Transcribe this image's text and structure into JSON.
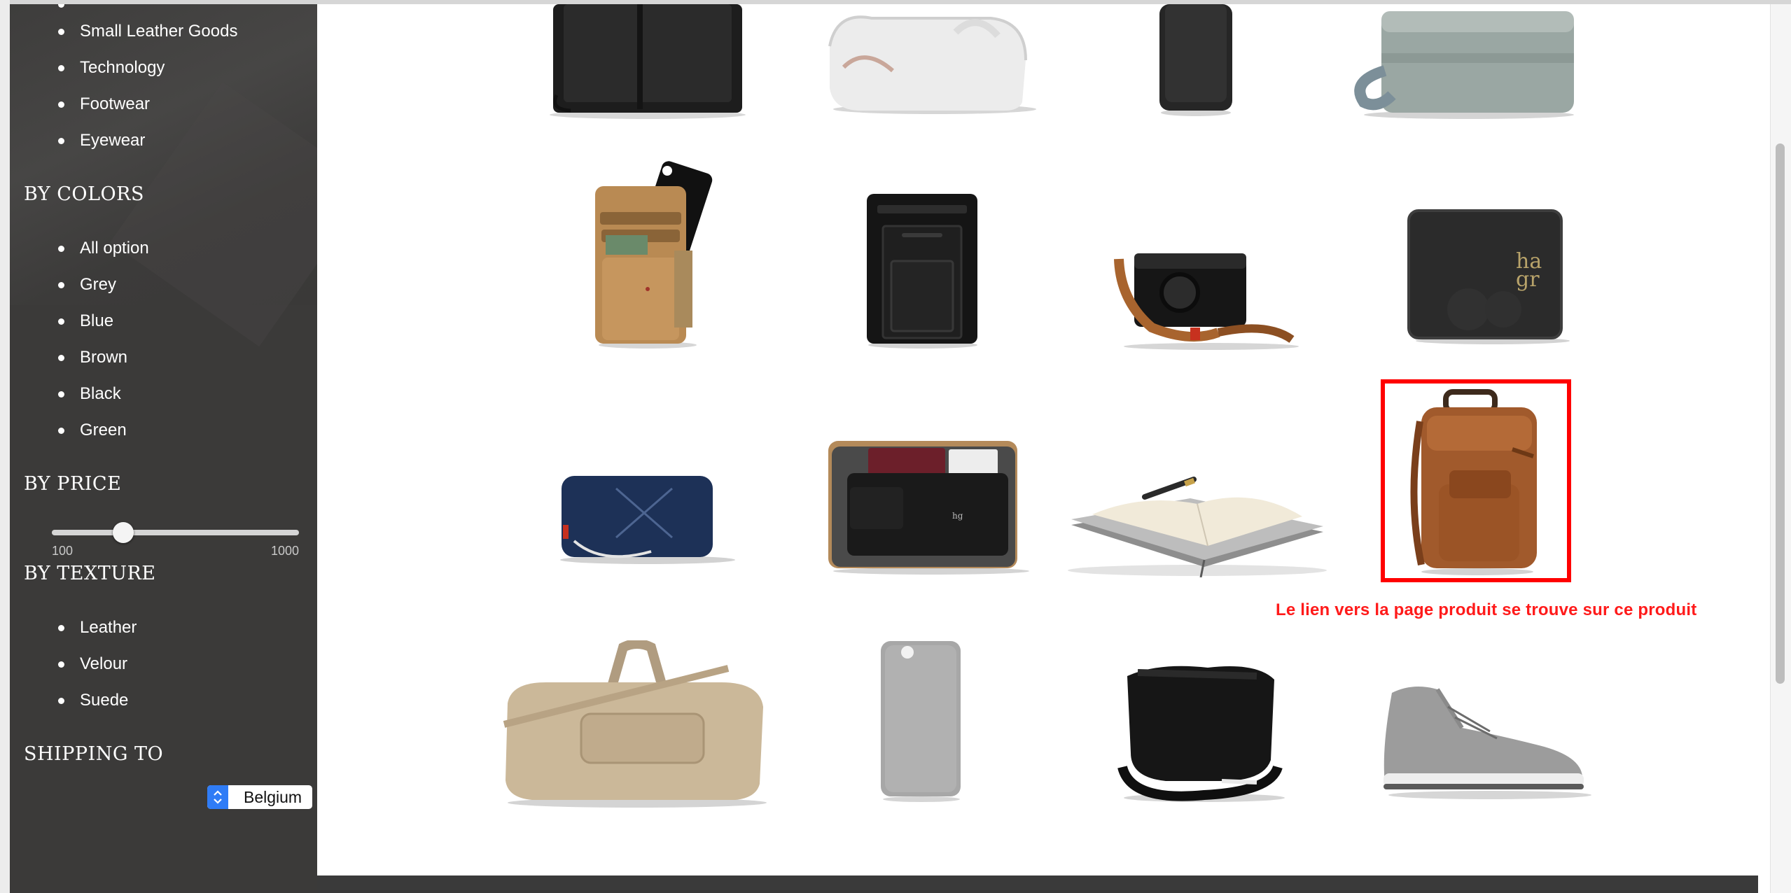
{
  "sidebar": {
    "categories_partial": "Small Leather Goods",
    "categories": [
      "Small Leather Goods",
      "Technology",
      "Footwear",
      "Eyewear"
    ],
    "colors_title": "BY COLORS",
    "colors": [
      "All option",
      "Grey",
      "Blue",
      "Brown",
      "Black",
      "Green"
    ],
    "price_title": "BY PRICE",
    "price_min": "100",
    "price_max": "1000",
    "price_value_fraction": 0.29,
    "texture_title": "BY TEXTURE",
    "textures": [
      "Leather",
      "Velour",
      "Suede"
    ],
    "shipping_title": "SHIPPING TO",
    "shipping_value": "Belgium"
  },
  "annotation": {
    "note": "Le lien vers la page produit se trouve sur ce produit",
    "color": "#ff0000"
  },
  "products": [
    "black-leather-folio",
    "white-toiletry-bag",
    "black-phone-sleeve",
    "grey-toiletry-case",
    "tan-phone-wallet",
    "black-card-wallet",
    "camera-strap",
    "black-leather-wallet",
    "navy-pouch",
    "felt-passport-holder",
    "leather-notebook",
    "brown-leather-backpack",
    "beige-suede-duffel",
    "grey-phone-case",
    "black-shoulder-bag",
    "grey-sneaker"
  ]
}
